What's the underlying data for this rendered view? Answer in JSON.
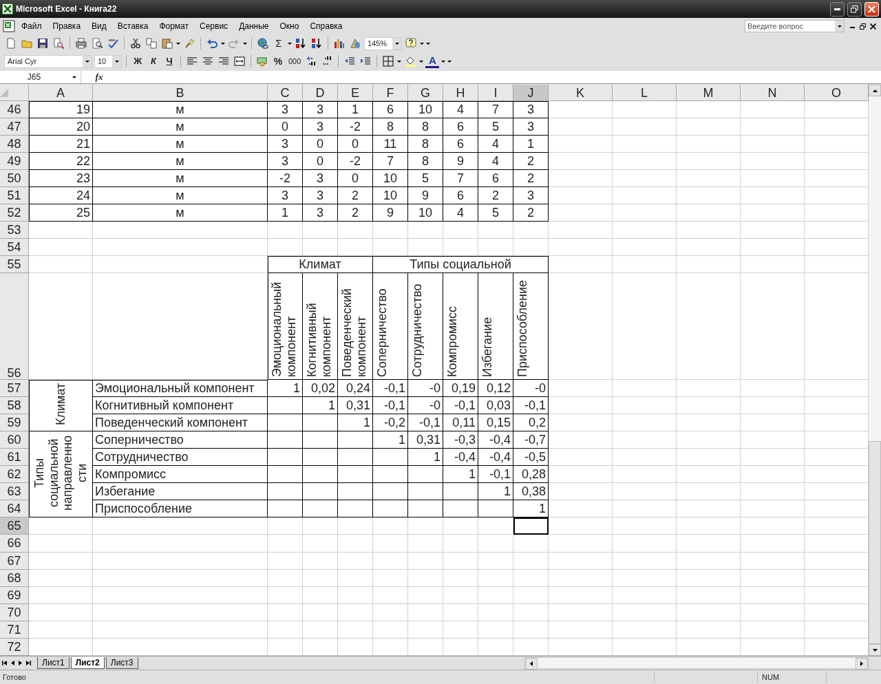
{
  "window": {
    "title": "Microsoft Excel - Книга22"
  },
  "menu": {
    "items": [
      "Файл",
      "Правка",
      "Вид",
      "Вставка",
      "Формат",
      "Сервис",
      "Данные",
      "Окно",
      "Справка"
    ],
    "question_placeholder": "Введите вопрос"
  },
  "standard_toolbar": {
    "sum": "Σ",
    "zoom": "145%"
  },
  "format_toolbar": {
    "font": "Arial Cyr",
    "size": "10",
    "bold": "Ж",
    "italic": "К",
    "underline": "Ч",
    "percent": "%",
    "thousands": "000",
    "font_color": "A"
  },
  "formula_bar": {
    "name_box": "J65",
    "fx": "fx"
  },
  "grid": {
    "columns": [
      {
        "label": "A",
        "selected": false
      },
      {
        "label": "B",
        "selected": false
      },
      {
        "label": "C",
        "selected": false
      },
      {
        "label": "D",
        "selected": false
      },
      {
        "label": "E",
        "selected": false
      },
      {
        "label": "F",
        "selected": false
      },
      {
        "label": "G",
        "selected": false
      },
      {
        "label": "H",
        "selected": false
      },
      {
        "label": "I",
        "selected": false
      },
      {
        "label": "J",
        "selected": true
      },
      {
        "label": "K",
        "selected": false
      },
      {
        "label": "L",
        "selected": false
      },
      {
        "label": "M",
        "selected": false
      },
      {
        "label": "N",
        "selected": false
      },
      {
        "label": "O",
        "selected": false
      }
    ],
    "rows": [
      {
        "number": "46",
        "selected": false,
        "cells": [
          {
            "text": "19",
            "kind": "number",
            "bordered": true
          },
          {
            "text": "м",
            "kind": "center",
            "bordered": true
          },
          {
            "text": "3",
            "kind": "center",
            "bordered": true
          },
          {
            "text": "3",
            "kind": "center",
            "bordered": true
          },
          {
            "text": "1",
            "kind": "center",
            "bordered": true
          },
          {
            "text": "6",
            "kind": "center",
            "bordered": true
          },
          {
            "text": "10",
            "kind": "center",
            "bordered": true
          },
          {
            "text": "4",
            "kind": "center",
            "bordered": true
          },
          {
            "text": "7",
            "kind": "center",
            "bordered": true
          },
          {
            "text": "3",
            "kind": "center",
            "bordered": true
          }
        ]
      },
      {
        "number": "47",
        "selected": false,
        "cells": [
          {
            "text": "20",
            "kind": "number",
            "bordered": true
          },
          {
            "text": "м",
            "kind": "center",
            "bordered": true
          },
          {
            "text": "0",
            "kind": "center",
            "bordered": true
          },
          {
            "text": "3",
            "kind": "center",
            "bordered": true
          },
          {
            "text": "-2",
            "kind": "center",
            "bordered": true
          },
          {
            "text": "8",
            "kind": "center",
            "bordered": true
          },
          {
            "text": "8",
            "kind": "center",
            "bordered": true
          },
          {
            "text": "6",
            "kind": "center",
            "bordered": true
          },
          {
            "text": "5",
            "kind": "center",
            "bordered": true
          },
          {
            "text": "3",
            "kind": "center",
            "bordered": true
          }
        ]
      },
      {
        "number": "48",
        "selected": false,
        "cells": [
          {
            "text": "21",
            "kind": "number",
            "bordered": true
          },
          {
            "text": "м",
            "kind": "center",
            "bordered": true
          },
          {
            "text": "3",
            "kind": "center",
            "bordered": true
          },
          {
            "text": "0",
            "kind": "center",
            "bordered": true
          },
          {
            "text": "0",
            "kind": "center",
            "bordered": true
          },
          {
            "text": "11",
            "kind": "center",
            "bordered": true
          },
          {
            "text": "8",
            "kind": "center",
            "bordered": true
          },
          {
            "text": "6",
            "kind": "center",
            "bordered": true
          },
          {
            "text": "4",
            "kind": "center",
            "bordered": true
          },
          {
            "text": "1",
            "kind": "center",
            "bordered": true
          }
        ]
      },
      {
        "number": "49",
        "selected": false,
        "cells": [
          {
            "text": "22",
            "kind": "number",
            "bordered": true
          },
          {
            "text": "м",
            "kind": "center",
            "bordered": true
          },
          {
            "text": "3",
            "kind": "center",
            "bordered": true
          },
          {
            "text": "0",
            "kind": "center",
            "bordered": true
          },
          {
            "text": "-2",
            "kind": "center",
            "bordered": true
          },
          {
            "text": "7",
            "kind": "center",
            "bordered": true
          },
          {
            "text": "8",
            "kind": "center",
            "bordered": true
          },
          {
            "text": "9",
            "kind": "center",
            "bordered": true
          },
          {
            "text": "4",
            "kind": "center",
            "bordered": true
          },
          {
            "text": "2",
            "kind": "center",
            "bordered": true
          }
        ]
      },
      {
        "number": "50",
        "selected": false,
        "cells": [
          {
            "text": "23",
            "kind": "number",
            "bordered": true
          },
          {
            "text": "м",
            "kind": "center",
            "bordered": true
          },
          {
            "text": "-2",
            "kind": "center",
            "bordered": true
          },
          {
            "text": "3",
            "kind": "center",
            "bordered": true
          },
          {
            "text": "0",
            "kind": "center",
            "bordered": true
          },
          {
            "text": "10",
            "kind": "center",
            "bordered": true
          },
          {
            "text": "5",
            "kind": "center",
            "bordered": true
          },
          {
            "text": "7",
            "kind": "center",
            "bordered": true
          },
          {
            "text": "6",
            "kind": "center",
            "bordered": true
          },
          {
            "text": "2",
            "kind": "center",
            "bordered": true
          }
        ]
      },
      {
        "number": "51",
        "selected": false,
        "cells": [
          {
            "text": "24",
            "kind": "number",
            "bordered": true
          },
          {
            "text": "м",
            "kind": "center",
            "bordered": true
          },
          {
            "text": "3",
            "kind": "center",
            "bordered": true
          },
          {
            "text": "3",
            "kind": "center",
            "bordered": true
          },
          {
            "text": "2",
            "kind": "center",
            "bordered": true
          },
          {
            "text": "10",
            "kind": "center",
            "bordered": true
          },
          {
            "text": "9",
            "kind": "center",
            "bordered": true
          },
          {
            "text": "6",
            "kind": "center",
            "bordered": true
          },
          {
            "text": "2",
            "kind": "center",
            "bordered": true
          },
          {
            "text": "3",
            "kind": "center",
            "bordered": true
          }
        ]
      },
      {
        "number": "52",
        "selected": false,
        "cells": [
          {
            "text": "25",
            "kind": "number",
            "bordered": true
          },
          {
            "text": "м",
            "kind": "center",
            "bordered": true
          },
          {
            "text": "1",
            "kind": "center",
            "bordered": true
          },
          {
            "text": "3",
            "kind": "center",
            "bordered": true
          },
          {
            "text": "2",
            "kind": "center",
            "bordered": true
          },
          {
            "text": "9",
            "kind": "center",
            "bordered": true
          },
          {
            "text": "10",
            "kind": "center",
            "bordered": true
          },
          {
            "text": "4",
            "kind": "center",
            "bordered": true
          },
          {
            "text": "5",
            "kind": "center",
            "bordered": true
          },
          {
            "text": "2",
            "kind": "center",
            "bordered": true
          }
        ]
      },
      {
        "number": "53",
        "selected": false,
        "cells": []
      },
      {
        "number": "54",
        "selected": false,
        "cells": []
      },
      {
        "number": "55",
        "selected": false,
        "cells": [
          {
            "kind": "empty",
            "bordered": false
          },
          {
            "kind": "empty",
            "bordered": false
          },
          {
            "text": "Климат",
            "kind": "center",
            "colspan": 3,
            "bordered": true
          },
          {
            "text": "Типы социальной",
            "kind": "center",
            "colspan": 5,
            "bordered": true
          }
        ]
      },
      {
        "number": "56",
        "selected": false,
        "cells": [
          {
            "kind": "empty",
            "bordered": false
          },
          {
            "kind": "empty",
            "bordered": false
          },
          {
            "text": "Эмоциональный компонент",
            "kind": "vertical",
            "bordered": true
          },
          {
            "text": "Когнитивный компонент",
            "kind": "vertical",
            "bordered": true
          },
          {
            "text": "Поведенческий компонент",
            "kind": "vertical",
            "bordered": true
          },
          {
            "text": "Соперничество",
            "kind": "vertical",
            "bordered": true
          },
          {
            "text": "Сотрудничество",
            "kind": "vertical",
            "bordered": true
          },
          {
            "text": "Компромисс",
            "kind": "vertical",
            "bordered": true
          },
          {
            "text": "Избегание",
            "kind": "vertical",
            "bordered": true
          },
          {
            "text": "Приспособление",
            "kind": "vertical",
            "bordered": true
          }
        ]
      },
      {
        "number": "57",
        "selected": false,
        "cells": [
          {
            "text": "Климат",
            "kind": "vertical",
            "rowspan": 3,
            "bordered": true
          },
          {
            "text": "Эмоциональный компонент",
            "kind": "label",
            "bordered": true
          },
          {
            "text": "1",
            "kind": "number",
            "bordered": true
          },
          {
            "text": "0,02",
            "kind": "number",
            "bordered": true
          },
          {
            "text": "0,24",
            "kind": "number",
            "bordered": true
          },
          {
            "text": "-0,1",
            "kind": "number",
            "bordered": true
          },
          {
            "text": "-0",
            "kind": "number",
            "bordered": true
          },
          {
            "text": "0,19",
            "kind": "number",
            "bordered": true
          },
          {
            "text": "0,12",
            "kind": "number",
            "bordered": true
          },
          {
            "text": "-0",
            "kind": "number",
            "bordered": true
          }
        ]
      },
      {
        "number": "58",
        "selected": false,
        "cells": [
          {
            "text": "Когнитивный компонент",
            "kind": "label",
            "bordered": true
          },
          {
            "kind": "empty",
            "bordered": true
          },
          {
            "text": "1",
            "kind": "number",
            "bordered": true
          },
          {
            "text": "0,31",
            "kind": "number",
            "bordered": true
          },
          {
            "text": "-0,1",
            "kind": "number",
            "bordered": true
          },
          {
            "text": "-0",
            "kind": "number",
            "bordered": true
          },
          {
            "text": "-0,1",
            "kind": "number",
            "bordered": true
          },
          {
            "text": "0,03",
            "kind": "number",
            "bordered": true
          },
          {
            "text": "-0,1",
            "kind": "number",
            "bordered": true
          }
        ]
      },
      {
        "number": "59",
        "selected": false,
        "cells": [
          {
            "text": "Поведенческий компонент",
            "kind": "label",
            "bordered": true
          },
          {
            "kind": "empty",
            "bordered": true
          },
          {
            "kind": "empty",
            "bordered": true
          },
          {
            "text": "1",
            "kind": "number",
            "bordered": true
          },
          {
            "text": "-0,2",
            "kind": "number",
            "bordered": true
          },
          {
            "text": "-0,1",
            "kind": "number",
            "bordered": true
          },
          {
            "text": "0,11",
            "kind": "number",
            "bordered": true
          },
          {
            "text": "0,15",
            "kind": "number",
            "bordered": true
          },
          {
            "text": "0,2",
            "kind": "number",
            "bordered": true
          }
        ]
      },
      {
        "number": "60",
        "selected": false,
        "cells": [
          {
            "text": "Типы социальной направленно сти",
            "kind": "vertical",
            "rowspan": 5,
            "bordered": true
          },
          {
            "text": "Соперничество",
            "kind": "label",
            "bordered": true
          },
          {
            "kind": "empty",
            "bordered": true
          },
          {
            "kind": "empty",
            "bordered": true
          },
          {
            "kind": "empty",
            "bordered": true
          },
          {
            "text": "1",
            "kind": "number",
            "bordered": true
          },
          {
            "text": "0,31",
            "kind": "number",
            "bordered": true
          },
          {
            "text": "-0,3",
            "kind": "number",
            "bordered": true
          },
          {
            "text": "-0,4",
            "kind": "number",
            "bordered": true
          },
          {
            "text": "-0,7",
            "kind": "number",
            "bordered": true
          }
        ]
      },
      {
        "number": "61",
        "selected": false,
        "cells": [
          {
            "text": "Сотрудничество",
            "kind": "label",
            "bordered": true
          },
          {
            "kind": "empty",
            "bordered": true
          },
          {
            "kind": "empty",
            "bordered": true
          },
          {
            "kind": "empty",
            "bordered": true
          },
          {
            "kind": "empty",
            "bordered": true
          },
          {
            "text": "1",
            "kind": "number",
            "bordered": true
          },
          {
            "text": "-0,4",
            "kind": "number",
            "bordered": true
          },
          {
            "text": "-0,4",
            "kind": "number",
            "bordered": true
          },
          {
            "text": "-0,5",
            "kind": "number",
            "bordered": true
          }
        ]
      },
      {
        "number": "62",
        "selected": false,
        "cells": [
          {
            "text": "Компромисс",
            "kind": "label",
            "bordered": true
          },
          {
            "kind": "empty",
            "bordered": true
          },
          {
            "kind": "empty",
            "bordered": true
          },
          {
            "kind": "empty",
            "bordered": true
          },
          {
            "kind": "empty",
            "bordered": true
          },
          {
            "kind": "empty",
            "bordered": true
          },
          {
            "text": "1",
            "kind": "number",
            "bordered": true
          },
          {
            "text": "-0,1",
            "kind": "number",
            "bordered": true
          },
          {
            "text": "0,28",
            "kind": "number",
            "bordered": true
          }
        ]
      },
      {
        "number": "63",
        "selected": false,
        "cells": [
          {
            "text": "Избегание",
            "kind": "label",
            "bordered": true
          },
          {
            "kind": "empty",
            "bordered": true
          },
          {
            "kind": "empty",
            "bordered": true
          },
          {
            "kind": "empty",
            "bordered": true
          },
          {
            "kind": "empty",
            "bordered": true
          },
          {
            "kind": "empty",
            "bordered": true
          },
          {
            "kind": "empty",
            "bordered": true
          },
          {
            "text": "1",
            "kind": "number",
            "bordered": true
          },
          {
            "text": "0,38",
            "kind": "number",
            "bordered": true
          }
        ]
      },
      {
        "number": "64",
        "selected": false,
        "cells": [
          {
            "text": "Приспособление",
            "kind": "label",
            "bordered": true
          },
          {
            "kind": "empty",
            "bordered": true
          },
          {
            "kind": "empty",
            "bordered": true
          },
          {
            "kind": "empty",
            "bordered": true
          },
          {
            "kind": "empty",
            "bordered": true
          },
          {
            "kind": "empty",
            "bordered": true
          },
          {
            "kind": "empty",
            "bordered": true
          },
          {
            "kind": "empty",
            "bordered": true
          },
          {
            "text": "1",
            "kind": "number",
            "bordered": true
          }
        ]
      },
      {
        "number": "65",
        "selected": true,
        "cells": [
          {
            "kind": "empty",
            "bordered": false
          },
          {
            "kind": "empty",
            "bordered": false
          },
          {
            "kind": "empty",
            "bordered": false
          },
          {
            "kind": "empty",
            "bordered": false
          },
          {
            "kind": "empty",
            "bordered": false
          },
          {
            "kind": "empty",
            "bordered": false
          },
          {
            "kind": "empty",
            "bordered": false
          },
          {
            "kind": "empty",
            "bordered": false
          },
          {
            "kind": "empty",
            "bordered": false
          },
          {
            "kind": "active"
          }
        ]
      },
      {
        "number": "66",
        "selected": false,
        "cells": []
      },
      {
        "number": "67",
        "selected": false,
        "cells": []
      },
      {
        "number": "68",
        "selected": false,
        "cells": []
      },
      {
        "number": "69",
        "selected": false,
        "cells": []
      },
      {
        "number": "70",
        "selected": false,
        "cells": []
      },
      {
        "number": "71",
        "selected": false,
        "cells": []
      },
      {
        "number": "72",
        "selected": false,
        "cells": []
      }
    ]
  },
  "sheet_tabs": [
    {
      "label": "Лист1",
      "selected": false
    },
    {
      "label": "Лист2",
      "selected": true
    },
    {
      "label": "Лист3",
      "selected": false
    }
  ],
  "status_bar": {
    "text": "Готово",
    "indicator": "NUM"
  }
}
